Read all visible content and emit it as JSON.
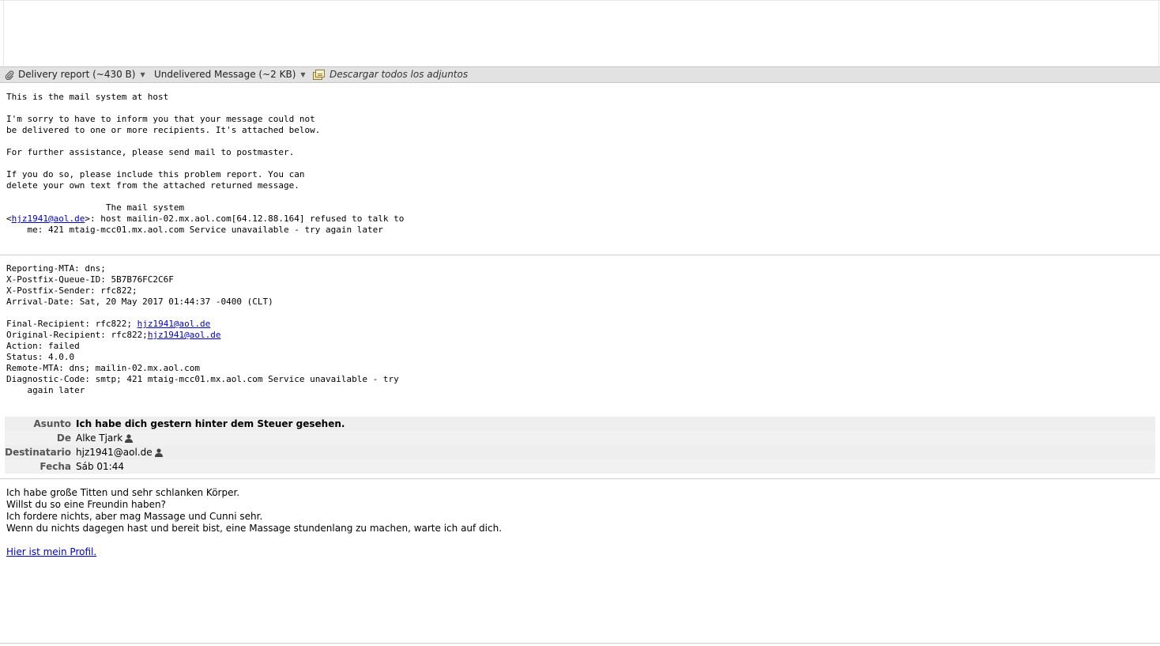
{
  "attachments": {
    "item1_label": "Delivery report (~430 B)",
    "item2_label": "Undelivered Message (~2 KB)",
    "download_all_label": "Descargar todos los adjuntos"
  },
  "report": {
    "intro": "This is the mail system at host\n\nI'm sorry to have to inform you that your message could not\nbe delivered to one or more recipients. It's attached below.\n\nFor further assistance, please send mail to postmaster.\n\nIf you do so, please include this problem report. You can\ndelete your own text from the attached returned message.\n\n                   The mail system\n",
    "recipient_prefix": "<",
    "recipient_email": "hjz1941@aol.de",
    "recipient_rest": ">: host mailin-02.mx.aol.com[64.12.88.164] refused to talk to\n    me: 421 mtaig-mcc01.mx.aol.com Service unavailable - try again later"
  },
  "status": {
    "part1": "Reporting-MTA: dns;\nX-Postfix-Queue-ID: 5B7B76FC2C6F\nX-Postfix-Sender: rfc822; \nArrival-Date: Sat, 20 May 2017 01:44:37 -0400 (CLT)\n\nFinal-Recipient: rfc822; ",
    "final_email": "hjz1941@aol.de",
    "part2": "\nOriginal-Recipient: rfc822;",
    "original_email": "hjz1941@aol.de",
    "part3": "\nAction: failed\nStatus: 4.0.0\nRemote-MTA: dns; mailin-02.mx.aol.com\nDiagnostic-Code: smtp; 421 mtaig-mcc01.mx.aol.com Service unavailable - try\n    again later"
  },
  "headers": {
    "subject_label": "Asunto",
    "subject_value": "Ich habe dich gestern hinter dem Steuer gesehen.",
    "from_label": "De",
    "from_value": "Alke Tjark",
    "to_label": "Destinatario",
    "to_value": "hjz1941@aol.de",
    "date_label": "Fecha",
    "date_value": "Sáb 01:44"
  },
  "message": {
    "line1": "Ich habe große Titten und sehr schlanken Körper.",
    "line2": "Willst du so eine Freundin haben?",
    "line3": "Ich fordere nichts, aber mag Massage und Cunni sehr.",
    "line4": "Wenn du nichts dagegen hast und bereit bist, eine Massage stundenlang zu machen, warte ich auf dich.",
    "link": "Hier ist mein Profil."
  },
  "icons": {
    "attachment": "paperclip-icon",
    "download": "download-all-icon",
    "person": "person-icon"
  }
}
